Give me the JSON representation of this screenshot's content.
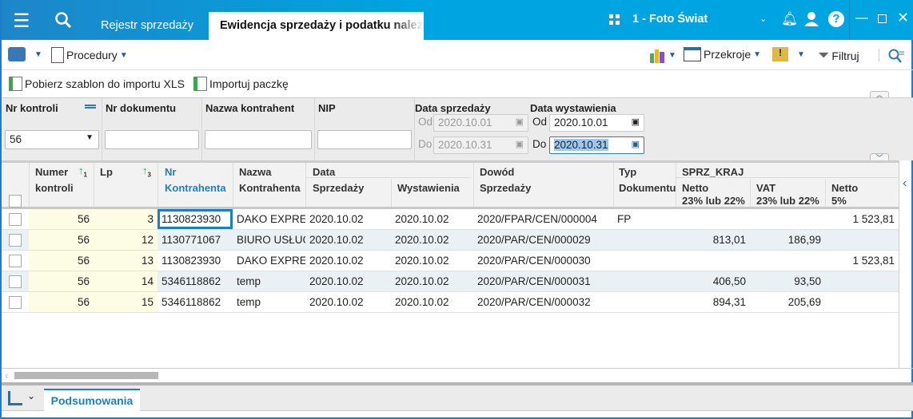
{
  "titlebar": {
    "tabs": [
      {
        "label": "Rejestr sprzedaży"
      },
      {
        "label": "Ewidencja sprzedaży i podatku należnego"
      }
    ],
    "company": "1 - Foto Świat",
    "accent": "#00a4e0"
  },
  "toolbar": {
    "procedury": "Procedury",
    "przekroje": "Przekroje",
    "filtruj": "Filtruj"
  },
  "actions": {
    "pobierz": "Pobierz szablon do importu XLS",
    "importuj": "Importuj paczkę"
  },
  "filters": {
    "nr_kontroli": {
      "label": "Nr kontroli",
      "value": "56"
    },
    "nr_dokumentu": {
      "label": "Nr dokumentu",
      "value": ""
    },
    "nazwa": {
      "label": "Nazwa kontrahent",
      "value": ""
    },
    "nip": {
      "label": "NIP",
      "value": ""
    },
    "data_sprzedazy": {
      "label": "Data sprzedaży",
      "od_label": "Od",
      "od": "2020.10.01",
      "do_label": "Do",
      "do": "2020.10.31"
    },
    "data_wystawienia": {
      "label": "Data wystawienia",
      "od_label": "Od",
      "od": "2020.10.01",
      "do_label": "Do",
      "do": "2020.10.31"
    }
  },
  "grid": {
    "headers": {
      "numer": "Numer",
      "kontroli": "kontroli",
      "sort1": "1",
      "lp": "Lp",
      "sort3": "3",
      "nr": "Nr",
      "kontrahenta": "Kontrahenta",
      "nazwa": "Nazwa",
      "nazwa2": "Kontrahenta",
      "data": "Data",
      "sprzedazy": "Sprzedaży",
      "wystawienia": "Wystawienia",
      "dowod": "Dowód",
      "dowod2": "Sprzedaży",
      "typ": "Typ",
      "typ2": "Dokumentu",
      "group": "SPRZ_KRAJ",
      "netto": "Netto",
      "netto_rate": "23% lub 22%",
      "vat": "VAT",
      "vat_rate": "23% lub 22%",
      "netto5": "Netto",
      "netto5_rate": "5%"
    },
    "rows": [
      [
        "56",
        "3",
        "1130823930",
        "DAKO EXPRESS",
        "2020.10.02",
        "2020.10.02",
        "2020/FPAR/CEN/000004",
        "FP",
        "",
        "",
        "1 523,81"
      ],
      [
        "56",
        "12",
        "1130771067",
        "BIURO USŁUG",
        "2020.10.02",
        "2020.10.02",
        "2020/PAR/CEN/000029",
        "",
        "813,01",
        "186,99",
        ""
      ],
      [
        "56",
        "13",
        "1130823930",
        "DAKO EXPRESS",
        "2020.10.02",
        "2020.10.02",
        "2020/PAR/CEN/000030",
        "",
        "",
        "",
        "1 523,81"
      ],
      [
        "56",
        "14",
        "5346118862",
        "temp",
        "2020.10.02",
        "2020.10.02",
        "2020/PAR/CEN/000031",
        "",
        "406,50",
        "93,50",
        ""
      ],
      [
        "56",
        "15",
        "5346118862",
        "temp",
        "2020.10.02",
        "2020.10.02",
        "2020/PAR/CEN/000032",
        "",
        "894,31",
        "205,69",
        ""
      ]
    ]
  },
  "bottom": {
    "tab": "Podsumowania"
  }
}
